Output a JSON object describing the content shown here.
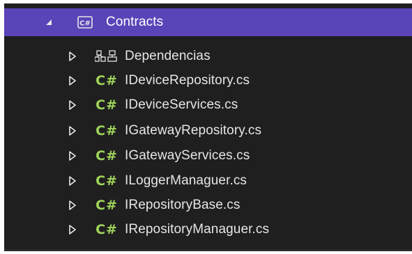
{
  "solution_explorer": {
    "project": {
      "label": "Contracts",
      "icon": "csharp-project-icon",
      "expanded": true
    },
    "items": [
      {
        "label": "Dependencias",
        "icon": "dependencies-icon"
      },
      {
        "label": "IDeviceRepository.cs",
        "icon": "csharp-file-icon"
      },
      {
        "label": "IDeviceServices.cs",
        "icon": "csharp-file-icon"
      },
      {
        "label": "IGatewayRepository.cs",
        "icon": "csharp-file-icon"
      },
      {
        "label": "IGatewayServices.cs",
        "icon": "csharp-file-icon"
      },
      {
        "label": "ILoggerManaguer.cs",
        "icon": "csharp-file-icon"
      },
      {
        "label": "IRepositoryBase.cs",
        "icon": "csharp-file-icon"
      },
      {
        "label": "IRepositoryManaguer.cs",
        "icon": "csharp-file-icon"
      }
    ],
    "colors": {
      "background": "#1f1f1f",
      "selection": "#5b43b8",
      "csharp_icon": "#9fd45a",
      "text": "#e6e6e6"
    }
  }
}
